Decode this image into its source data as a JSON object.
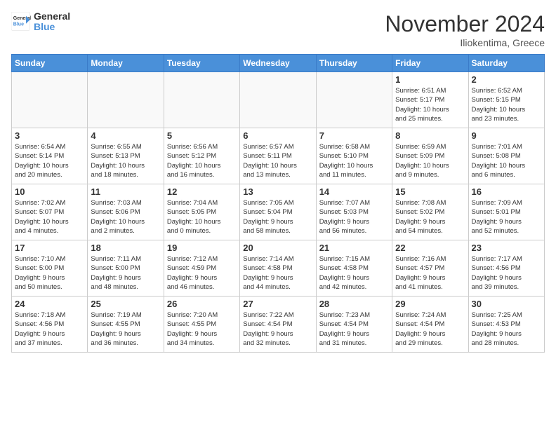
{
  "header": {
    "logo_general": "General",
    "logo_blue": "Blue",
    "month_title": "November 2024",
    "location": "Iliokentima, Greece"
  },
  "weekdays": [
    "Sunday",
    "Monday",
    "Tuesday",
    "Wednesday",
    "Thursday",
    "Friday",
    "Saturday"
  ],
  "weeks": [
    [
      {
        "day": "",
        "info": ""
      },
      {
        "day": "",
        "info": ""
      },
      {
        "day": "",
        "info": ""
      },
      {
        "day": "",
        "info": ""
      },
      {
        "day": "",
        "info": ""
      },
      {
        "day": "1",
        "info": "Sunrise: 6:51 AM\nSunset: 5:17 PM\nDaylight: 10 hours\nand 25 minutes."
      },
      {
        "day": "2",
        "info": "Sunrise: 6:52 AM\nSunset: 5:15 PM\nDaylight: 10 hours\nand 23 minutes."
      }
    ],
    [
      {
        "day": "3",
        "info": "Sunrise: 6:54 AM\nSunset: 5:14 PM\nDaylight: 10 hours\nand 20 minutes."
      },
      {
        "day": "4",
        "info": "Sunrise: 6:55 AM\nSunset: 5:13 PM\nDaylight: 10 hours\nand 18 minutes."
      },
      {
        "day": "5",
        "info": "Sunrise: 6:56 AM\nSunset: 5:12 PM\nDaylight: 10 hours\nand 16 minutes."
      },
      {
        "day": "6",
        "info": "Sunrise: 6:57 AM\nSunset: 5:11 PM\nDaylight: 10 hours\nand 13 minutes."
      },
      {
        "day": "7",
        "info": "Sunrise: 6:58 AM\nSunset: 5:10 PM\nDaylight: 10 hours\nand 11 minutes."
      },
      {
        "day": "8",
        "info": "Sunrise: 6:59 AM\nSunset: 5:09 PM\nDaylight: 10 hours\nand 9 minutes."
      },
      {
        "day": "9",
        "info": "Sunrise: 7:01 AM\nSunset: 5:08 PM\nDaylight: 10 hours\nand 6 minutes."
      }
    ],
    [
      {
        "day": "10",
        "info": "Sunrise: 7:02 AM\nSunset: 5:07 PM\nDaylight: 10 hours\nand 4 minutes."
      },
      {
        "day": "11",
        "info": "Sunrise: 7:03 AM\nSunset: 5:06 PM\nDaylight: 10 hours\nand 2 minutes."
      },
      {
        "day": "12",
        "info": "Sunrise: 7:04 AM\nSunset: 5:05 PM\nDaylight: 10 hours\nand 0 minutes."
      },
      {
        "day": "13",
        "info": "Sunrise: 7:05 AM\nSunset: 5:04 PM\nDaylight: 9 hours\nand 58 minutes."
      },
      {
        "day": "14",
        "info": "Sunrise: 7:07 AM\nSunset: 5:03 PM\nDaylight: 9 hours\nand 56 minutes."
      },
      {
        "day": "15",
        "info": "Sunrise: 7:08 AM\nSunset: 5:02 PM\nDaylight: 9 hours\nand 54 minutes."
      },
      {
        "day": "16",
        "info": "Sunrise: 7:09 AM\nSunset: 5:01 PM\nDaylight: 9 hours\nand 52 minutes."
      }
    ],
    [
      {
        "day": "17",
        "info": "Sunrise: 7:10 AM\nSunset: 5:00 PM\nDaylight: 9 hours\nand 50 minutes."
      },
      {
        "day": "18",
        "info": "Sunrise: 7:11 AM\nSunset: 5:00 PM\nDaylight: 9 hours\nand 48 minutes."
      },
      {
        "day": "19",
        "info": "Sunrise: 7:12 AM\nSunset: 4:59 PM\nDaylight: 9 hours\nand 46 minutes."
      },
      {
        "day": "20",
        "info": "Sunrise: 7:14 AM\nSunset: 4:58 PM\nDaylight: 9 hours\nand 44 minutes."
      },
      {
        "day": "21",
        "info": "Sunrise: 7:15 AM\nSunset: 4:58 PM\nDaylight: 9 hours\nand 42 minutes."
      },
      {
        "day": "22",
        "info": "Sunrise: 7:16 AM\nSunset: 4:57 PM\nDaylight: 9 hours\nand 41 minutes."
      },
      {
        "day": "23",
        "info": "Sunrise: 7:17 AM\nSunset: 4:56 PM\nDaylight: 9 hours\nand 39 minutes."
      }
    ],
    [
      {
        "day": "24",
        "info": "Sunrise: 7:18 AM\nSunset: 4:56 PM\nDaylight: 9 hours\nand 37 minutes."
      },
      {
        "day": "25",
        "info": "Sunrise: 7:19 AM\nSunset: 4:55 PM\nDaylight: 9 hours\nand 36 minutes."
      },
      {
        "day": "26",
        "info": "Sunrise: 7:20 AM\nSunset: 4:55 PM\nDaylight: 9 hours\nand 34 minutes."
      },
      {
        "day": "27",
        "info": "Sunrise: 7:22 AM\nSunset: 4:54 PM\nDaylight: 9 hours\nand 32 minutes."
      },
      {
        "day": "28",
        "info": "Sunrise: 7:23 AM\nSunset: 4:54 PM\nDaylight: 9 hours\nand 31 minutes."
      },
      {
        "day": "29",
        "info": "Sunrise: 7:24 AM\nSunset: 4:54 PM\nDaylight: 9 hours\nand 29 minutes."
      },
      {
        "day": "30",
        "info": "Sunrise: 7:25 AM\nSunset: 4:53 PM\nDaylight: 9 hours\nand 28 minutes."
      }
    ]
  ]
}
